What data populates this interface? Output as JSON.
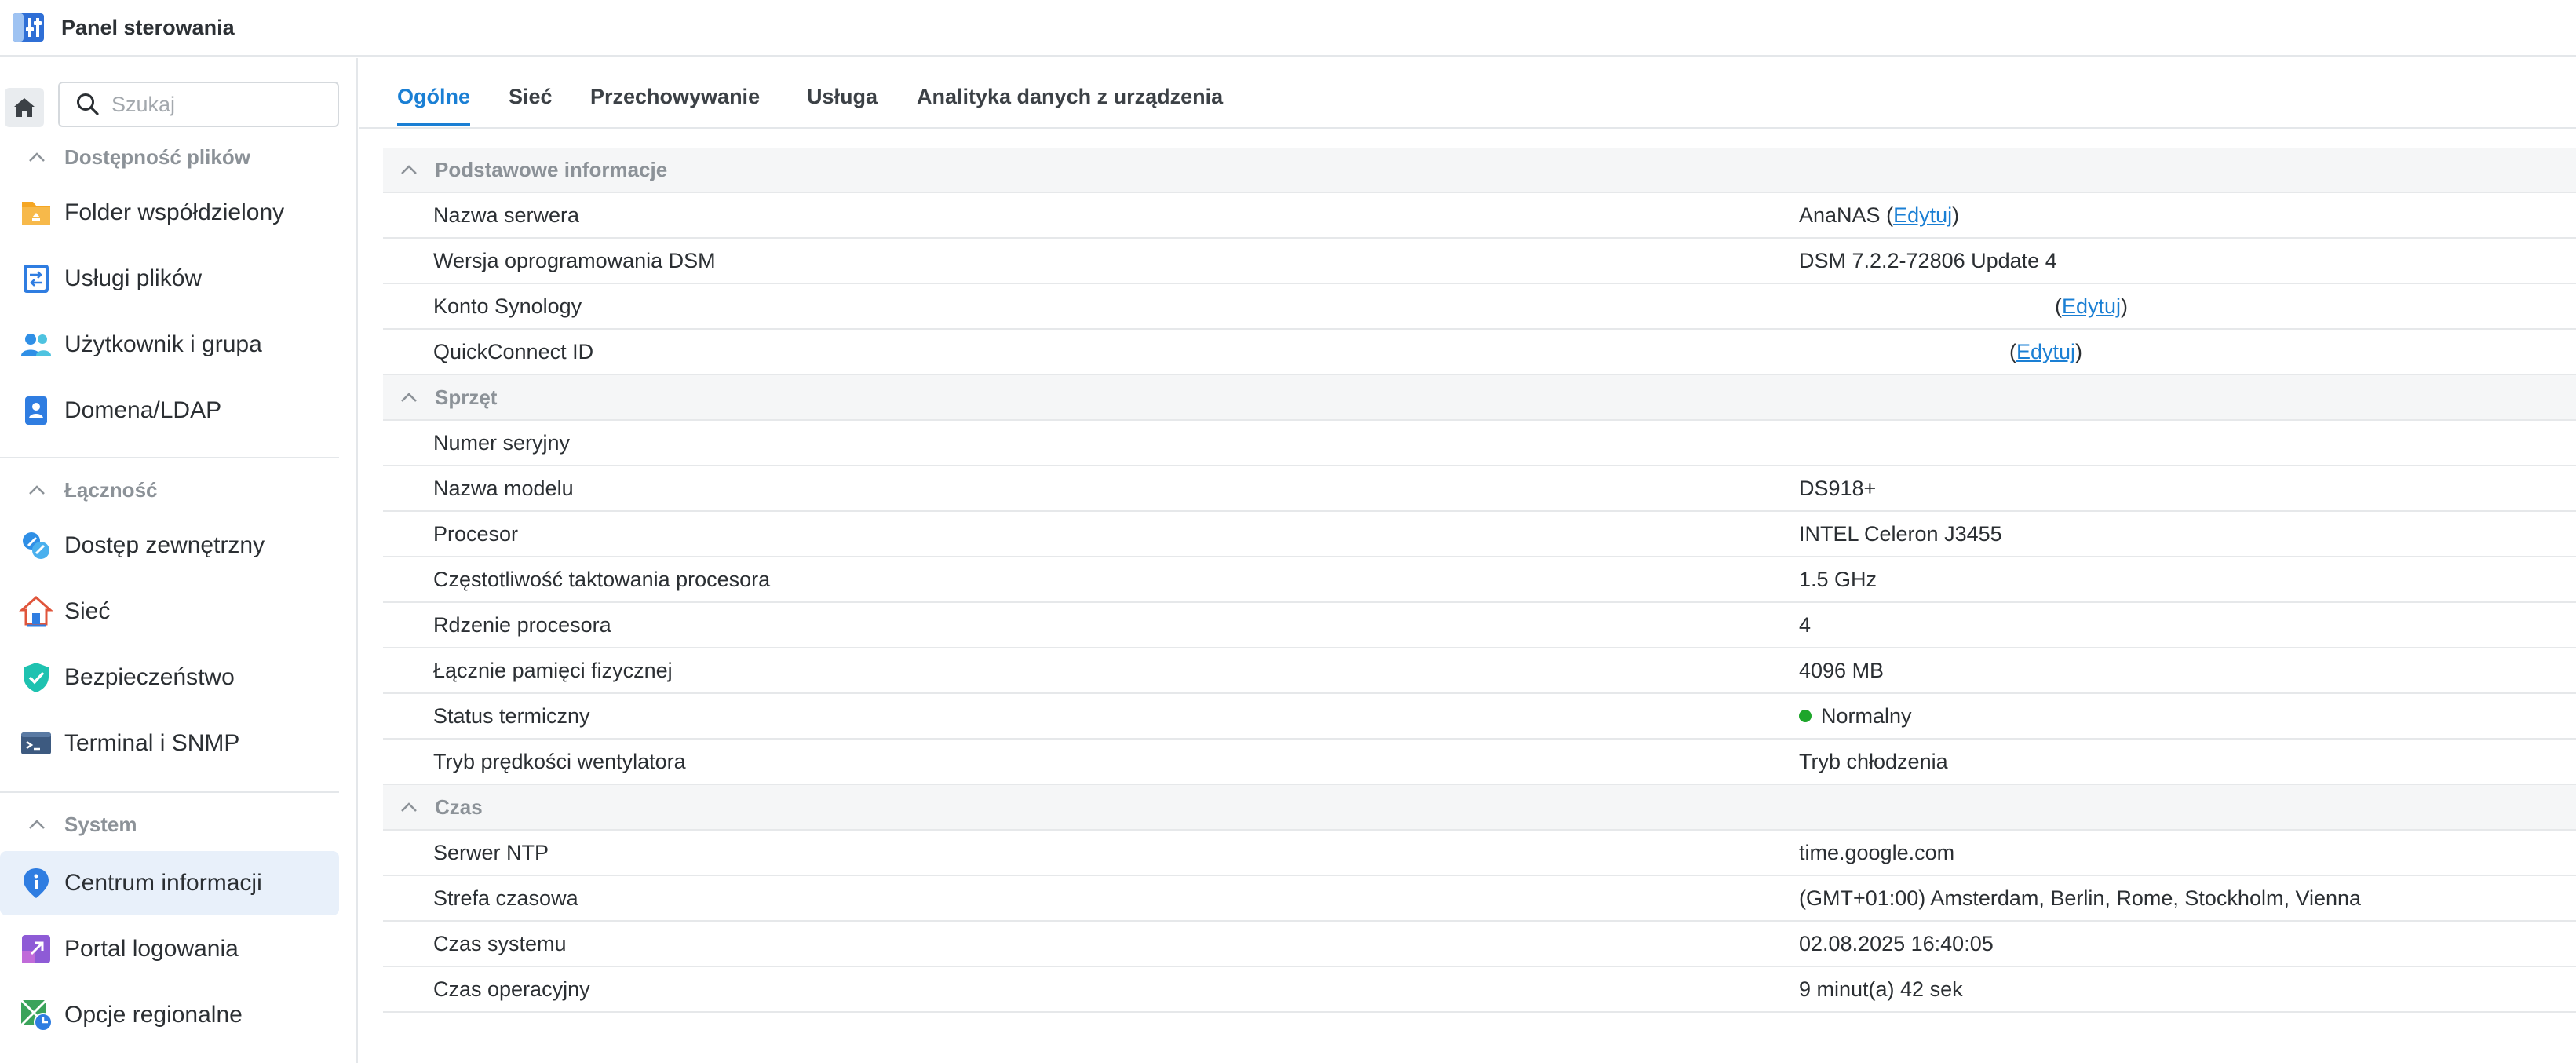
{
  "window": {
    "title": "Panel sterowania"
  },
  "search": {
    "placeholder": "Szukaj"
  },
  "sidebar": {
    "groups": [
      {
        "title": "Dostępność plików",
        "items": [
          {
            "label": "Folder współdzielony",
            "icon": "shared-folder-icon"
          },
          {
            "label": "Usługi plików",
            "icon": "file-services-icon"
          },
          {
            "label": "Użytkownik i grupa",
            "icon": "users-icon"
          },
          {
            "label": "Domena/LDAP",
            "icon": "domain-ldap-icon"
          }
        ]
      },
      {
        "title": "Łączność",
        "items": [
          {
            "label": "Dostęp zewnętrzny",
            "icon": "external-access-icon"
          },
          {
            "label": "Sieć",
            "icon": "network-house-icon"
          },
          {
            "label": "Bezpieczeństwo",
            "icon": "security-shield-icon"
          },
          {
            "label": "Terminal i SNMP",
            "icon": "terminal-icon"
          }
        ]
      },
      {
        "title": "System",
        "items": [
          {
            "label": "Centrum informacji",
            "icon": "info-center-icon",
            "active": true
          },
          {
            "label": "Portal logowania",
            "icon": "login-portal-icon"
          },
          {
            "label": "Opcje regionalne",
            "icon": "regional-options-icon"
          }
        ]
      }
    ]
  },
  "tabs": [
    "Ogólne",
    "Sieć",
    "Przechowywanie",
    "Usługa",
    "Analityka danych z urządzenia"
  ],
  "sections": {
    "basic": {
      "title": "Podstawowe informacje",
      "server_name_label": "Nazwa serwera",
      "server_name_value": "AnaNAS",
      "dsm_label": "Wersja oprogramowania DSM",
      "dsm_value": "DSM 7.2.2-72806 Update 4",
      "account_label": "Konto Synology",
      "quickconnect_label": "QuickConnect ID",
      "edit_link": "Edytuj"
    },
    "hardware": {
      "title": "Sprzęt",
      "serial_label": "Numer seryjny",
      "model_label": "Nazwa modelu",
      "model_value": "DS918+",
      "cpu_label": "Procesor",
      "cpu_value": "INTEL Celeron J3455",
      "freq_label": "Częstotliwość taktowania procesora",
      "freq_value": "1.5 GHz",
      "cores_label": "Rdzenie procesora",
      "cores_value": "4",
      "mem_label": "Łącznie pamięci fizycznej",
      "mem_value": "4096 MB",
      "thermal_label": "Status termiczny",
      "thermal_value": "Normalny",
      "fan_label": "Tryb prędkości wentylatora",
      "fan_value": "Tryb chłodzenia"
    },
    "time": {
      "title": "Czas",
      "ntp_label": "Serwer NTP",
      "ntp_value": "time.google.com",
      "tz_label": "Strefa czasowa",
      "tz_value": "(GMT+01:00) Amsterdam, Berlin, Rome, Stockholm, Vienna",
      "systime_label": "Czas systemu",
      "systime_value": "02.08.2025 16:40:05",
      "uptime_label": "Czas operacyjny",
      "uptime_value": "9 minut(a) 42 sek"
    }
  },
  "colors": {
    "accent": "#1a7fd4",
    "status_ok": "#1ea62b",
    "active_bg": "#e8f0fa"
  }
}
